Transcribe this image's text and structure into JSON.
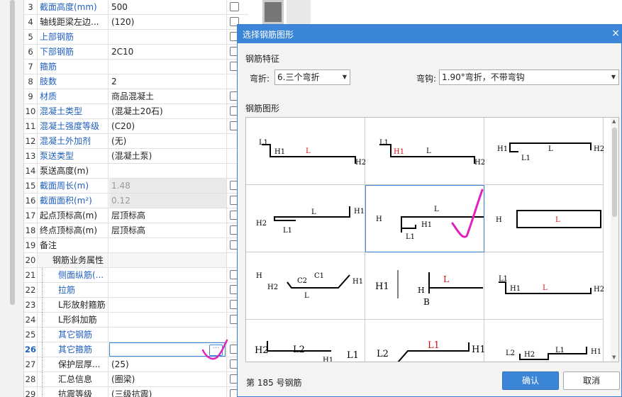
{
  "grid": {
    "rows": [
      {
        "n": "3",
        "name": "截面高度(mm)",
        "value": "500",
        "blue": true,
        "chk": true
      },
      {
        "n": "4",
        "name": "轴线距梁左边...",
        "value": "(120)",
        "blue": false,
        "chk": true
      },
      {
        "n": "5",
        "name": "上部钢筋",
        "value": "",
        "blue": true,
        "chk": true
      },
      {
        "n": "6",
        "name": "下部钢筋",
        "value": "2C10",
        "blue": true,
        "chk": true
      },
      {
        "n": "7",
        "name": "箍筋",
        "value": "",
        "blue": true,
        "chk": true
      },
      {
        "n": "8",
        "name": "肢数",
        "value": "2",
        "blue": true,
        "chk": false
      },
      {
        "n": "9",
        "name": "材质",
        "value": "商品混凝土",
        "blue": true,
        "chk": true
      },
      {
        "n": "10",
        "name": "混凝土类型",
        "value": "(混凝土20石)",
        "blue": true,
        "chk": true
      },
      {
        "n": "11",
        "name": "混凝土强度等级",
        "value": "(C20)",
        "blue": true,
        "chk": true
      },
      {
        "n": "12",
        "name": "混凝土外加剂",
        "value": "(无)",
        "blue": true,
        "chk": false
      },
      {
        "n": "13",
        "name": "泵送类型",
        "value": "(混凝土泵)",
        "blue": true,
        "chk": false
      },
      {
        "n": "14",
        "name": "泵送高度(m)",
        "value": "",
        "blue": false,
        "chk": false
      },
      {
        "n": "15",
        "name": "截面周长(m)",
        "value": "1.48",
        "blue": true,
        "chk": true,
        "disabled": true
      },
      {
        "n": "16",
        "name": "截面面积(m²)",
        "value": "0.12",
        "blue": true,
        "chk": true,
        "disabled": true
      },
      {
        "n": "17",
        "name": "起点顶标高(m)",
        "value": "层顶标高",
        "blue": false,
        "chk": true
      },
      {
        "n": "18",
        "name": "终点顶标高(m)",
        "value": "层顶标高",
        "blue": false,
        "chk": true
      },
      {
        "n": "19",
        "name": "备注",
        "value": "",
        "blue": false,
        "chk": true
      },
      {
        "n": "20",
        "name": "钢筋业务属性",
        "value": "",
        "blue": false,
        "chk": false,
        "section": true
      },
      {
        "n": "21",
        "name": "侧面纵筋(...",
        "value": "",
        "blue": true,
        "chk": true,
        "indent": true
      },
      {
        "n": "22",
        "name": "拉筋",
        "value": "",
        "blue": true,
        "chk": true,
        "indent": true
      },
      {
        "n": "23",
        "name": "L形放射箍筋",
        "value": "",
        "blue": false,
        "chk": true,
        "indent": true
      },
      {
        "n": "24",
        "name": "L形斜加筋",
        "value": "",
        "blue": false,
        "chk": true,
        "indent": true
      },
      {
        "n": "25",
        "name": "其它钢筋",
        "value": "",
        "blue": true,
        "chk": false,
        "indent": true
      },
      {
        "n": "26",
        "name": "其它箍筋",
        "value": "",
        "blue": true,
        "chk": true,
        "indent": true,
        "active": true
      },
      {
        "n": "27",
        "name": "保护层厚...",
        "value": "(25)",
        "blue": false,
        "chk": true,
        "indent": true
      },
      {
        "n": "28",
        "name": "汇总信息",
        "value": "(圈梁)",
        "blue": false,
        "chk": true,
        "indent": true
      },
      {
        "n": "29",
        "name": "抗震等级",
        "value": "(三级抗震)",
        "blue": false,
        "chk": true,
        "indent": true
      }
    ],
    "ellipsis_label": "···",
    "minus_label": "−"
  },
  "dialog": {
    "title": "选择钢筋图形",
    "close_label": "×",
    "feature_label": "钢筋特征",
    "bend_label": "弯折:",
    "bend_value": "6.三个弯折",
    "hook_label": "弯钩:",
    "hook_value": "1.90°弯折，不带弯钩",
    "shape_label": "钢筋图形",
    "status": "第 185 号钢筋",
    "ok_label": "确认",
    "cancel_label": "取消"
  },
  "colors": {
    "accent": "#3c86d7",
    "annotation": "#e020c0",
    "dimension_red": "#d01010"
  }
}
